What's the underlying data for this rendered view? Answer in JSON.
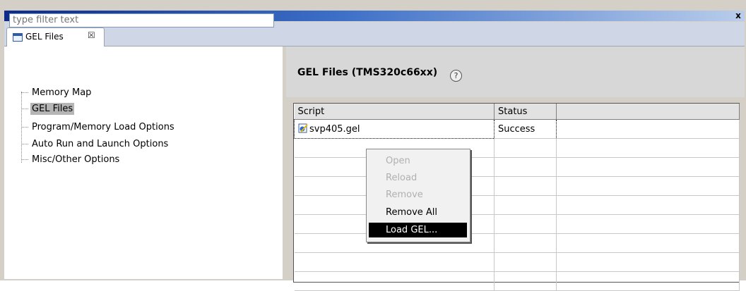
{
  "window": {
    "close_glyph": "x"
  },
  "tab": {
    "label": "GEL Files",
    "close_glyph": "☒"
  },
  "filter": {
    "placeholder": "type filter text"
  },
  "tree": {
    "items": [
      {
        "label": "Memory Map",
        "selected": false
      },
      {
        "label": "GEL Files",
        "selected": true
      },
      {
        "label": "Program/Memory Load Options",
        "selected": false
      },
      {
        "label": "Auto Run and Launch Options",
        "selected": false
      },
      {
        "label": "Misc/Other Options",
        "selected": false
      }
    ]
  },
  "panel": {
    "title": "GEL Files (TMS320c66xx)",
    "help_glyph": "?"
  },
  "table": {
    "columns": [
      "Script",
      "Status",
      ""
    ],
    "rows": [
      {
        "script": "svp405.gel",
        "status": "Success"
      }
    ]
  },
  "context_menu": {
    "items": [
      {
        "label": "Open",
        "enabled": false
      },
      {
        "label": "Reload",
        "enabled": false
      },
      {
        "label": "Remove",
        "enabled": false
      },
      {
        "label": "Remove All",
        "enabled": true
      },
      {
        "label": "Load GEL...",
        "enabled": true,
        "highlighted": true
      }
    ]
  }
}
